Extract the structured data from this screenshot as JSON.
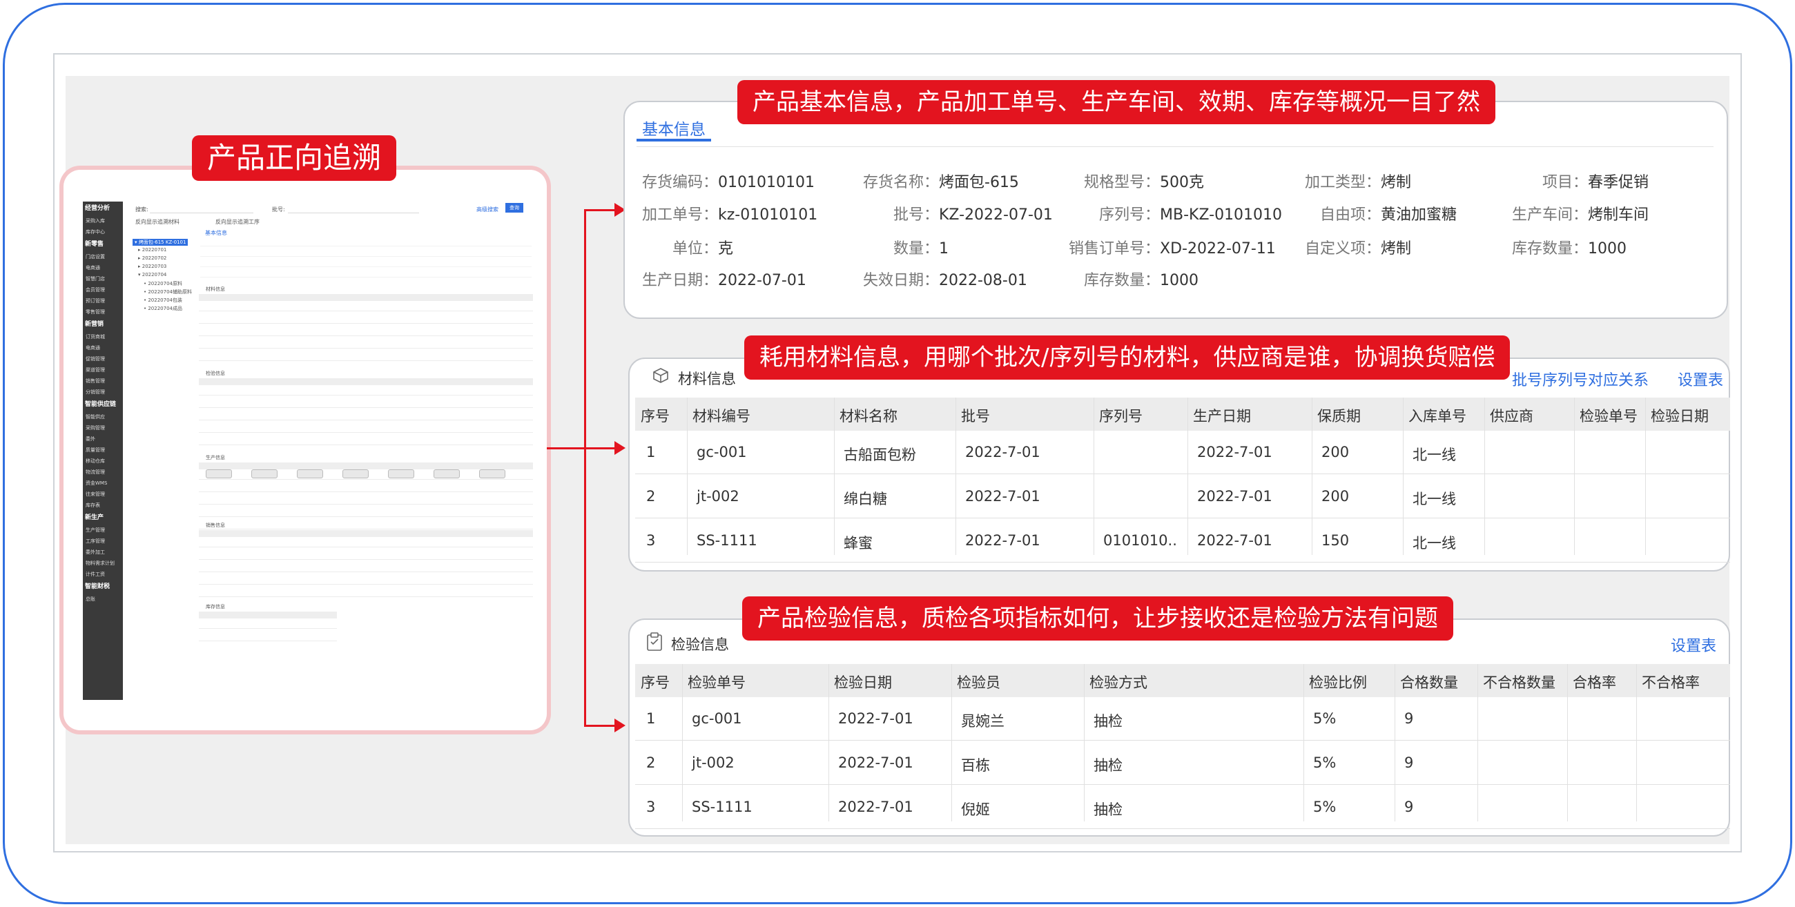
{
  "labels": {
    "forward_trace": "产品正向追溯",
    "basic_note": "产品基本信息，产品加工单号、生产车间、效期、库存等概况一目了然",
    "material_note": "耗用材料信息，用哪个批次/序列号的材料，供应商是谁，协调换货赔偿",
    "inspection_note": "产品检验信息，质检各项指标如何，让步接收还是检验方法有问题"
  },
  "basic": {
    "tab": "基本信息",
    "fields": [
      {
        "label": "存货编码：",
        "value": "0101010101"
      },
      {
        "label": "存货名称：",
        "value": "烤面包-615"
      },
      {
        "label": "规格型号：",
        "value": "500克"
      },
      {
        "label": "加工类型：",
        "value": "烤制"
      },
      {
        "label": "项目：",
        "value": "春季促销"
      },
      {
        "label": "加工单号：",
        "value": "kz-01010101"
      },
      {
        "label": "批号：",
        "value": "KZ-2022-07-01"
      },
      {
        "label": "序列号：",
        "value": "MB-KZ-0101010"
      },
      {
        "label": "自由项：",
        "value": "黄油加蜜糖"
      },
      {
        "label": "生产车间：",
        "value": "烤制车间"
      },
      {
        "label": "单位：",
        "value": "克"
      },
      {
        "label": "数量：",
        "value": "1"
      },
      {
        "label": "销售订单号：",
        "value": "XD-2022-07-11"
      },
      {
        "label": "自定义项：",
        "value": "烤制"
      },
      {
        "label": "库存数量：",
        "value": "1000"
      },
      {
        "label": "生产日期：",
        "value": "2022-07-01"
      },
      {
        "label": "失效日期：",
        "value": "2022-08-01"
      },
      {
        "label": "库存数量：",
        "value": "1000"
      }
    ]
  },
  "materials": {
    "title": "材料信息",
    "link1": "批号序列号对应关系",
    "link2": "设置表",
    "headers": [
      "序号",
      "材料编号",
      "材料名称",
      "批号",
      "序列号",
      "生产日期",
      "保质期",
      "入库单号",
      "供应商",
      "检验单号",
      "检验日期"
    ],
    "rows": [
      [
        "1",
        "gc-001",
        "古船面包粉",
        "2022-7-01",
        "",
        "2022-7-01",
        "200",
        "北一线",
        "",
        "",
        ""
      ],
      [
        "2",
        "jt-002",
        "绵白糖",
        "2022-7-01",
        "",
        "2022-7-01",
        "200",
        "北一线",
        "",
        "",
        ""
      ],
      [
        "3",
        "SS-1111",
        "蜂蜜",
        "2022-7-01",
        "0101010..",
        "2022-7-01",
        "150",
        "北一线",
        "",
        "",
        ""
      ]
    ]
  },
  "inspection": {
    "title": "检验信息",
    "link": "设置表",
    "headers": [
      "序号",
      "检验单号",
      "检验日期",
      "检验员",
      "检验方式",
      "检验比例",
      "合格数量",
      "不合格数量",
      "合格率",
      "不合格率"
    ],
    "rows": [
      [
        "1",
        "gc-001",
        "2022-7-01",
        "晁婉兰",
        "抽检",
        "5%",
        "9",
        "",
        "",
        ""
      ],
      [
        "2",
        "jt-002",
        "2022-7-01",
        "百栋",
        "抽检",
        "5%",
        "9",
        "",
        "",
        ""
      ],
      [
        "3",
        "SS-1111",
        "2022-7-01",
        "倪姬",
        "抽检",
        "5%",
        "9",
        "",
        "",
        ""
      ]
    ]
  },
  "mini": {
    "search_label": "搜索:",
    "batch_label": "批号:",
    "query_btn": "查询",
    "more": "高级搜索",
    "option1": "反向显示追溯材料",
    "option2": "反向显示追溯工序",
    "tab": "基本信息",
    "tree": [
      "▾ 烤面包-615 KZ-0101",
      "▸ 20220701",
      "▸ 20220702",
      "▸ 20220703",
      "▾ 20220704",
      "• 20220704原料",
      "• 20220704辅助原料",
      "• 20220704包装",
      "• 20220704成品"
    ],
    "sections": [
      "材料信息",
      "检验信息",
      "生产信息",
      "销售信息",
      "库存信息"
    ],
    "sidebar": [
      {
        "t": "h",
        "text": "经营分析"
      },
      {
        "t": "i",
        "text": "采购入库"
      },
      {
        "t": "i",
        "text": "库存中心"
      },
      {
        "t": "h",
        "text": "新零售"
      },
      {
        "t": "i",
        "text": "门店设置"
      },
      {
        "t": "i",
        "text": "电商通"
      },
      {
        "t": "i",
        "text": "智慧门店"
      },
      {
        "t": "i",
        "text": "会员管理"
      },
      {
        "t": "i",
        "text": "预订管理"
      },
      {
        "t": "i",
        "text": "零售管理"
      },
      {
        "t": "h",
        "text": "新营销"
      },
      {
        "t": "i",
        "text": "订货商城"
      },
      {
        "t": "i",
        "text": "电商通"
      },
      {
        "t": "i",
        "text": "促销管理"
      },
      {
        "t": "i",
        "text": "渠道管理"
      },
      {
        "t": "i",
        "text": "销售管理"
      },
      {
        "t": "i",
        "text": "分销管理"
      },
      {
        "t": "h",
        "text": "智能供应链"
      },
      {
        "t": "i",
        "text": "智能供应"
      },
      {
        "t": "i",
        "text": "采购管理"
      },
      {
        "t": "i",
        "text": "委外"
      },
      {
        "t": "i",
        "text": "质量管理"
      },
      {
        "t": "i",
        "text": "移动仓库"
      },
      {
        "t": "i",
        "text": "物流管理"
      },
      {
        "t": "i",
        "text": "资金WMS"
      },
      {
        "t": "i",
        "text": "往来管理"
      },
      {
        "t": "i",
        "text": "库存表"
      },
      {
        "t": "h",
        "text": "新生产"
      },
      {
        "t": "i",
        "text": "生产管理"
      },
      {
        "t": "i",
        "text": "工序管理"
      },
      {
        "t": "i",
        "text": "委外加工"
      },
      {
        "t": "i",
        "text": "物料需求计划"
      },
      {
        "t": "i",
        "text": "计件工资"
      },
      {
        "t": "h",
        "text": "智能财税"
      },
      {
        "t": "i",
        "text": "总账"
      }
    ]
  },
  "colors": {
    "accent": "#2f6fe0",
    "highlight": "#e3141f"
  }
}
